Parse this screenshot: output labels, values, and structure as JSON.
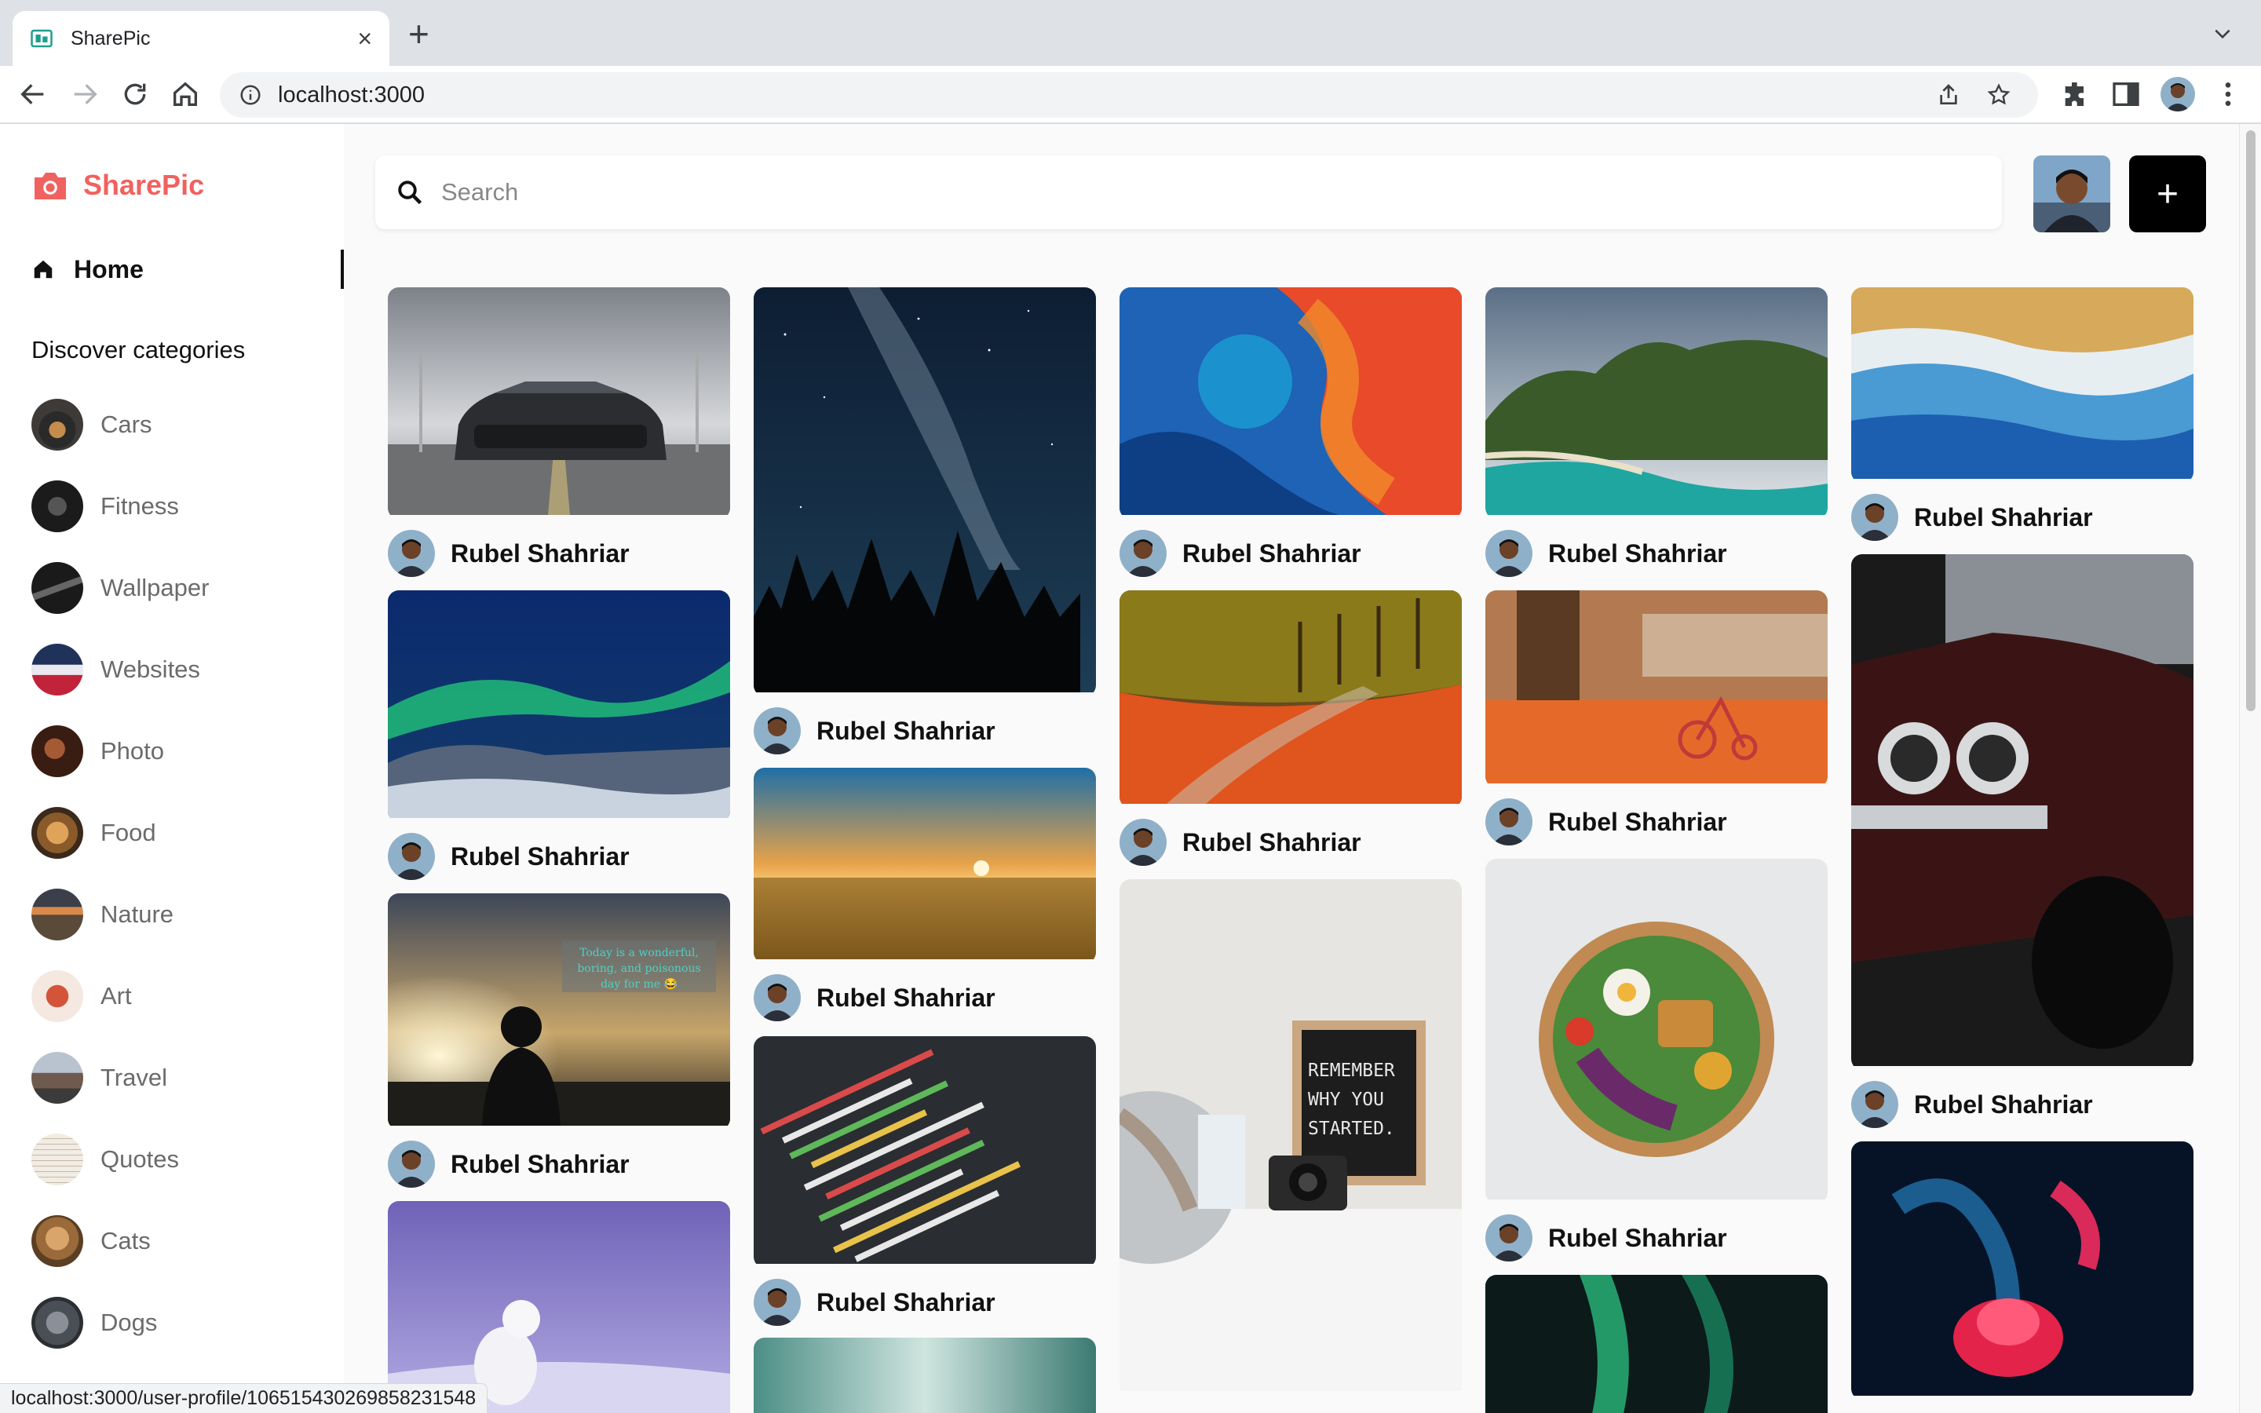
{
  "browser": {
    "tab_title": "SharePic",
    "url": "localhost:3000",
    "status_url": "localhost:3000/user-profile/106515430269858231548"
  },
  "sidebar": {
    "logo_text": "SharePic",
    "home_label": "Home",
    "discover_label": "Discover categories",
    "categories": [
      "Cars",
      "Fitness",
      "Wallpaper",
      "Websites",
      "Photo",
      "Food",
      "Nature",
      "Art",
      "Travel",
      "Quotes",
      "Cats",
      "Dogs"
    ]
  },
  "header": {
    "search_placeholder": "Search",
    "add_label": "+"
  },
  "pins": {
    "author": "Rubel Shahriar",
    "quote_overlay": "Today is a wonderful, boring, and poisonous day for me 😂",
    "letterboard": "REMEMBER WHY YOU STARTED."
  },
  "colors": {
    "brand": "#f0625f",
    "button": "#000000"
  }
}
